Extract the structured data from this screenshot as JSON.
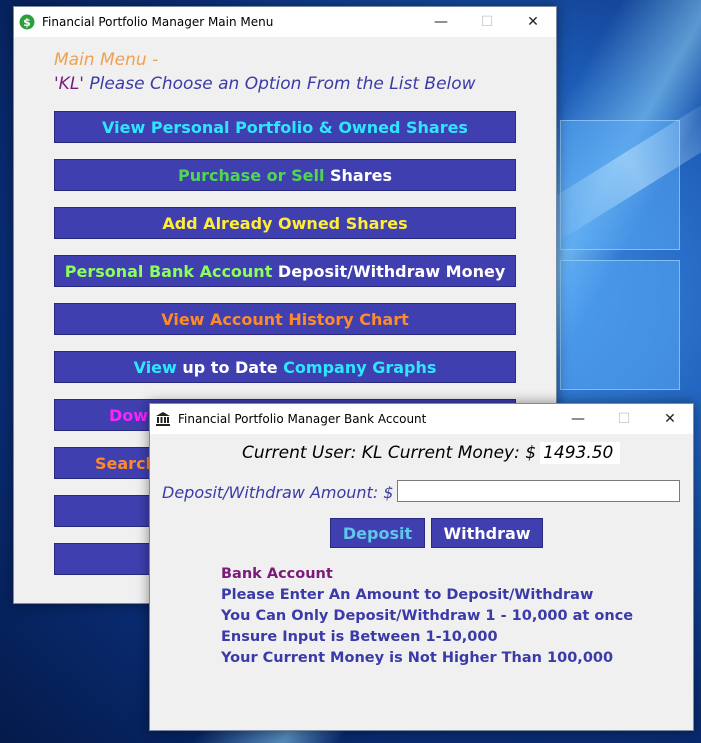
{
  "main_window": {
    "title": "Financial Portfolio Manager Main Menu",
    "heading": "Main Menu -",
    "subheading_user": "'KL'",
    "subheading_text": " Please Choose an Option From the List Below",
    "buttons": [
      {
        "parts": [
          {
            "text": "View Personal Portfolio & Owned Shares",
            "color": "#2ee6ff"
          }
        ]
      },
      {
        "parts": [
          {
            "text": "Purchase or Sell ",
            "color": "#4fd84f"
          },
          {
            "text": "Shares",
            "color": "#ffffff"
          }
        ]
      },
      {
        "parts": [
          {
            "text": "Add Already Owned Shares",
            "color": "#ffee33"
          }
        ]
      },
      {
        "parts": [
          {
            "text": "Personal Bank Account ",
            "color": "#8cff5a"
          },
          {
            "text": "Deposit/Withdraw Money",
            "color": "#ffffff"
          }
        ]
      },
      {
        "parts": [
          {
            "text": "View Account History Chart",
            "color": "#ff8a2a"
          }
        ]
      },
      {
        "parts": [
          {
            "text": "View ",
            "color": "#2ee6ff"
          },
          {
            "text": "up to Date ",
            "color": "#ffffff"
          },
          {
            "text": "Company Graphs",
            "color": "#2ee6ff"
          }
        ]
      },
      {
        "parts": [
          {
            "text": "Dow",
            "color": "#ff22ff"
          }
        ]
      },
      {
        "parts": [
          {
            "text": "Search",
            "color": "#ff8a2a"
          }
        ]
      },
      {
        "parts": []
      },
      {
        "parts": []
      }
    ]
  },
  "bank_window": {
    "title": "Financial Portfolio Manager Bank Account",
    "user_label": "Current User: KL Current Money: $",
    "current_money": "1493.50",
    "amount_label": "Deposit/Withdraw Amount: $",
    "amount_value": "",
    "deposit_label": "Deposit",
    "withdraw_label": "Withdraw",
    "info_title": "Bank Account",
    "info_lines": [
      "Please Enter An Amount to Deposit/Withdraw",
      "You Can Only Deposit/Withdraw 1 - 10,000 at once",
      "Ensure Input is Between 1-10,000",
      "Your Current Money is Not Higher Than 100,000"
    ]
  },
  "window_controls": {
    "minimize": "—",
    "maximize": "☐",
    "close": "✕"
  },
  "icons": {
    "main_window_icon": "dollar-icon",
    "bank_window_icon": "bank-icon"
  }
}
